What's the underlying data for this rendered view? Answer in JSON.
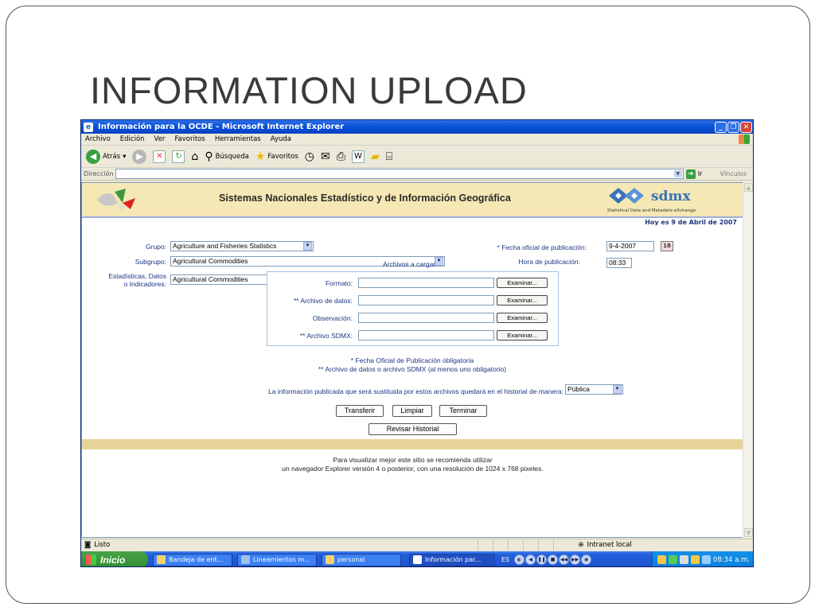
{
  "slide": {
    "title": "INFORMATION UPLOAD"
  },
  "window": {
    "title": "Información para la OCDE - Microsoft Internet Explorer"
  },
  "menu": [
    "Archivo",
    "Edición",
    "Ver",
    "Favoritos",
    "Herramientas",
    "Ayuda"
  ],
  "toolbar": {
    "back": "Atrás",
    "search": "Búsqueda",
    "favorites": "Favoritos"
  },
  "address": {
    "label": "Dirección",
    "go": "Ir",
    "links": "Vínculos"
  },
  "banner": {
    "title": "Sistemas Nacionales Estadístico y de Información Geográfica",
    "sdmx": "sdmx",
    "sdmx_sub": "Statistical Data and Metadata eXchange"
  },
  "date_line": "Hoy es 9 de Abril de 2007",
  "form": {
    "grupo_label": "Grupo:",
    "grupo_value": "Agriculture and Fisheries Statistics",
    "subgrupo_label": "Subgrupo:",
    "subgrupo_value": "Agricultural Commodities",
    "estadisticas_label_1": "Estadísticas, Datos",
    "estadisticas_label_2": "o Indicadores:",
    "estadisticas_value": "Agricultural Commodities",
    "fecha_label": "* Fecha oficial de publicación:",
    "fecha_value": "9-4-2007",
    "hora_label": "Hora de publicación:",
    "hora_value": "08:33"
  },
  "files": {
    "title": "Archivos a cargar",
    "rows": [
      {
        "label": "Formato:",
        "button": "Examinar..."
      },
      {
        "label": "** Archivo de datos:",
        "button": "Examinar..."
      },
      {
        "label": "Observación:",
        "button": "Examinar..."
      },
      {
        "label": "** Archivo SDMX:",
        "button": "Examinar..."
      }
    ]
  },
  "notes": {
    "line1": "* Fecha Oficial de Publicación obligatoria",
    "line2": "** Archivo de datos o archivo SDMX (al menos uno obligatorio)"
  },
  "history": {
    "label": "La información publicada que será sustituida por estos archivos quedará en el historial de manera:",
    "value": "Pública"
  },
  "buttons": {
    "transfer": "Transferir",
    "clear": "Limpiar",
    "finish": "Terminar",
    "history": "Revisar Historial"
  },
  "footer": {
    "line1": "Para visualizar mejor este sitio se recomienda utilizar",
    "line2": "un navegador Explorer versión 4 o posterior, con una resolución de 1024 x 768 pixeles."
  },
  "status": {
    "left": "Listo",
    "zone": "Intranet local"
  },
  "taskbar": {
    "start": "Inicio",
    "tasks": [
      "Bandeja de ent...",
      "Lineamientos m...",
      "personal",
      "Información par..."
    ],
    "lang": "ES",
    "clock": "08:34 a.m."
  }
}
